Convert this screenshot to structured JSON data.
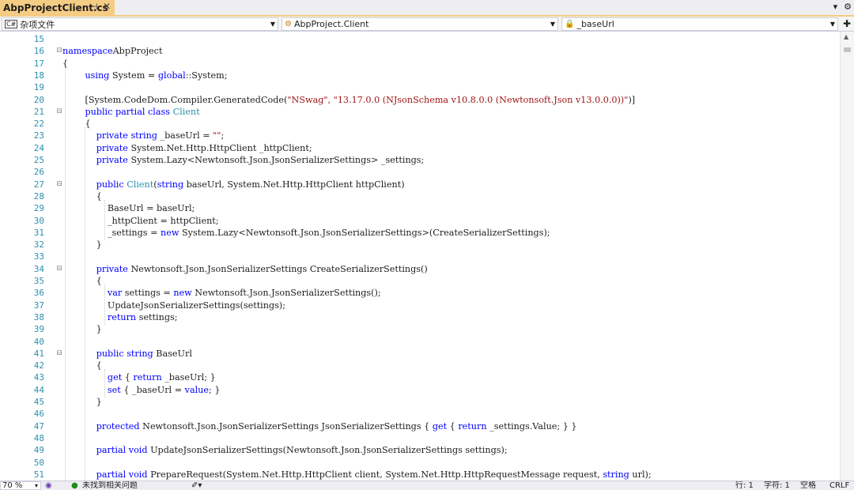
{
  "tab": {
    "title": "AbpProjectClient.cs",
    "pin": "⊣",
    "close": "✕"
  },
  "navbar": {
    "project": "杂项文件",
    "class": "AbpProject.Client",
    "member": "_baseUrl"
  },
  "status": {
    "zoom": "70 %",
    "issues": "未找到相关问题",
    "line": "行: 1",
    "char": "字符: 1",
    "spacing": "空格",
    "eol": "CRLF"
  },
  "code_lines": [
    {
      "n": "15",
      "fold": "",
      "segs": []
    },
    {
      "n": "16",
      "fold": "⊟",
      "segs": [
        [
          "kw",
          "namespace"
        ],
        [
          "",
          "AbpProject"
        ]
      ]
    },
    {
      "n": "17",
      "fold": "",
      "segs": [
        [
          "",
          "{"
        ]
      ]
    },
    {
      "n": "18",
      "fold": "",
      "segs": [
        [
          "",
          "        "
        ],
        [
          "kw",
          "using"
        ],
        [
          "",
          " System = "
        ],
        [
          "kw",
          "global"
        ],
        [
          "",
          "::System;"
        ]
      ]
    },
    {
      "n": "19",
      "fold": "",
      "segs": []
    },
    {
      "n": "20",
      "fold": "",
      "segs": [
        [
          "",
          "        [System.CodeDom.Compiler.GeneratedCode("
        ],
        [
          "st",
          "\"NSwag\", \"13.17.0.0 (NJsonSchema v10.8.0.0 (Newtonsoft.Json v13.0.0.0))\""
        ],
        [
          "",
          ")]"
        ]
      ]
    },
    {
      "n": "21",
      "fold": "⊟",
      "segs": [
        [
          "",
          "        "
        ],
        [
          "kw",
          "public partial class"
        ],
        [
          "",
          " "
        ],
        [
          "ty",
          "Client"
        ]
      ]
    },
    {
      "n": "22",
      "fold": "",
      "segs": [
        [
          "",
          "        {"
        ]
      ]
    },
    {
      "n": "23",
      "fold": "",
      "segs": [
        [
          "",
          "            "
        ],
        [
          "kw",
          "private string"
        ],
        [
          "",
          " _baseUrl = "
        ],
        [
          "st",
          "\"\""
        ],
        [
          "",
          ";"
        ]
      ]
    },
    {
      "n": "24",
      "fold": "",
      "segs": [
        [
          "",
          "            "
        ],
        [
          "kw",
          "private"
        ],
        [
          "",
          " System.Net.Http.HttpClient _httpClient;"
        ]
      ]
    },
    {
      "n": "25",
      "fold": "",
      "segs": [
        [
          "",
          "            "
        ],
        [
          "kw",
          "private"
        ],
        [
          "",
          " System.Lazy<Newtonsoft.Json.JsonSerializerSettings> _settings;"
        ]
      ]
    },
    {
      "n": "26",
      "fold": "",
      "segs": []
    },
    {
      "n": "27",
      "fold": "⊟",
      "segs": [
        [
          "",
          "            "
        ],
        [
          "kw",
          "public"
        ],
        [
          "",
          " "
        ],
        [
          "ty",
          "Client"
        ],
        [
          "",
          "("
        ],
        [
          "kw",
          "string"
        ],
        [
          "",
          " baseUrl, System.Net.Http.HttpClient httpClient)"
        ]
      ]
    },
    {
      "n": "28",
      "fold": "",
      "segs": [
        [
          "",
          "            {"
        ]
      ]
    },
    {
      "n": "29",
      "fold": "",
      "segs": [
        [
          "",
          "                BaseUrl = baseUrl;"
        ]
      ]
    },
    {
      "n": "30",
      "fold": "",
      "segs": [
        [
          "",
          "                _httpClient = httpClient;"
        ]
      ]
    },
    {
      "n": "31",
      "fold": "",
      "segs": [
        [
          "",
          "                _settings = "
        ],
        [
          "kw",
          "new"
        ],
        [
          "",
          " System.Lazy<Newtonsoft.Json.JsonSerializerSettings>(CreateSerializerSettings);"
        ]
      ]
    },
    {
      "n": "32",
      "fold": "",
      "segs": [
        [
          "",
          "            }"
        ]
      ]
    },
    {
      "n": "33",
      "fold": "",
      "segs": []
    },
    {
      "n": "34",
      "fold": "⊟",
      "segs": [
        [
          "",
          "            "
        ],
        [
          "kw",
          "private"
        ],
        [
          "",
          " Newtonsoft.Json.JsonSerializerSettings CreateSerializerSettings()"
        ]
      ]
    },
    {
      "n": "35",
      "fold": "",
      "segs": [
        [
          "",
          "            {"
        ]
      ]
    },
    {
      "n": "36",
      "fold": "",
      "segs": [
        [
          "",
          "                "
        ],
        [
          "kw",
          "var"
        ],
        [
          "",
          " settings = "
        ],
        [
          "kw",
          "new"
        ],
        [
          "",
          " Newtonsoft.Json.JsonSerializerSettings();"
        ]
      ]
    },
    {
      "n": "37",
      "fold": "",
      "segs": [
        [
          "",
          "                UpdateJsonSerializerSettings(settings);"
        ]
      ]
    },
    {
      "n": "38",
      "fold": "",
      "segs": [
        [
          "",
          "                "
        ],
        [
          "kw",
          "return"
        ],
        [
          "",
          " settings;"
        ]
      ]
    },
    {
      "n": "39",
      "fold": "",
      "segs": [
        [
          "",
          "            }"
        ]
      ]
    },
    {
      "n": "40",
      "fold": "",
      "segs": []
    },
    {
      "n": "41",
      "fold": "⊟",
      "segs": [
        [
          "",
          "            "
        ],
        [
          "kw",
          "public string"
        ],
        [
          "",
          " BaseUrl"
        ]
      ]
    },
    {
      "n": "42",
      "fold": "",
      "segs": [
        [
          "",
          "            {"
        ]
      ]
    },
    {
      "n": "43",
      "fold": "",
      "segs": [
        [
          "",
          "                "
        ],
        [
          "kw",
          "get"
        ],
        [
          "",
          " { "
        ],
        [
          "kw",
          "return"
        ],
        [
          "",
          " _baseUrl; }"
        ]
      ]
    },
    {
      "n": "44",
      "fold": "",
      "segs": [
        [
          "",
          "                "
        ],
        [
          "kw",
          "set"
        ],
        [
          "",
          " { _baseUrl = "
        ],
        [
          "kw",
          "value"
        ],
        [
          "",
          "; }"
        ]
      ]
    },
    {
      "n": "45",
      "fold": "",
      "segs": [
        [
          "",
          "            }"
        ]
      ]
    },
    {
      "n": "46",
      "fold": "",
      "segs": []
    },
    {
      "n": "47",
      "fold": "",
      "segs": [
        [
          "",
          "            "
        ],
        [
          "kw",
          "protected"
        ],
        [
          "",
          " Newtonsoft.Json.JsonSerializerSettings JsonSerializerSettings { "
        ],
        [
          "kw",
          "get"
        ],
        [
          "",
          " { "
        ],
        [
          "kw",
          "return"
        ],
        [
          "",
          " _settings.Value; } }"
        ]
      ]
    },
    {
      "n": "48",
      "fold": "",
      "segs": []
    },
    {
      "n": "49",
      "fold": "",
      "segs": [
        [
          "",
          "            "
        ],
        [
          "kw",
          "partial void"
        ],
        [
          "",
          " UpdateJsonSerializerSettings(Newtonsoft.Json.JsonSerializerSettings settings);"
        ]
      ]
    },
    {
      "n": "50",
      "fold": "",
      "segs": []
    },
    {
      "n": "51",
      "fold": "",
      "segs": [
        [
          "",
          "            "
        ],
        [
          "kw",
          "partial void"
        ],
        [
          "",
          " PrepareRequest(System.Net.Http.HttpClient client, System.Net.Http.HttpRequestMessage request, "
        ],
        [
          "kw",
          "string"
        ],
        [
          "",
          " url);"
        ]
      ]
    }
  ]
}
